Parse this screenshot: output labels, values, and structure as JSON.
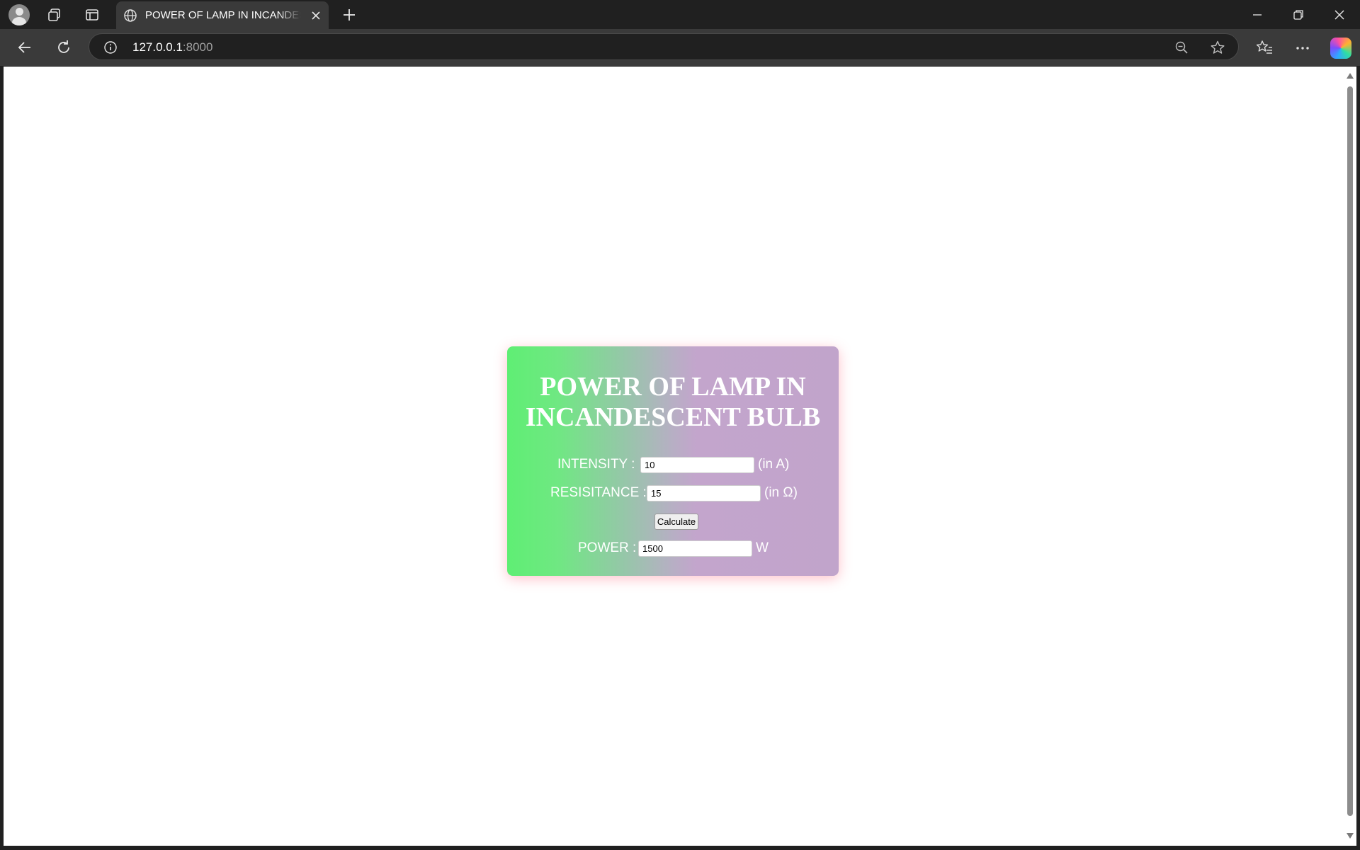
{
  "browser": {
    "tab_title": "POWER OF LAMP IN INCANDESCENT BULB",
    "url_host": "127.0.0.1",
    "url_port": ":8000"
  },
  "page": {
    "heading": "POWER OF LAMP IN INCANDESCENT BULB",
    "intensity": {
      "label": "INTENSITY :",
      "value": "10",
      "unit": "(in A)"
    },
    "resistance": {
      "label": "RESISITANCE :",
      "value": "15",
      "unit": "(in Ω)"
    },
    "calculate_label": "Calculate",
    "power": {
      "label": "POWER :",
      "value": "1500",
      "unit": "W"
    }
  },
  "colors": {
    "card_gradient_start": "#5fee74",
    "card_gradient_end": "#c1a4cb",
    "card_text": "#ffffff"
  }
}
